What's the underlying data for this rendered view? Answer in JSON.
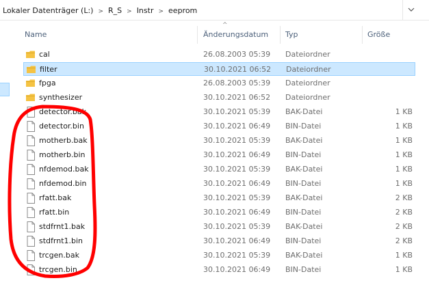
{
  "breadcrumb": [
    "Lokaler Datenträger (L:)",
    "R_S",
    "Instr",
    "eeprom"
  ],
  "columns": {
    "name": "Name",
    "date": "Änderungsdatum",
    "type": "Typ",
    "size": "Größe"
  },
  "colors": {
    "selection_bg": "#cce8ff",
    "selection_border": "#99d1ff",
    "folder": "#f5c343",
    "annotation": "#ff0000"
  },
  "files": [
    {
      "name": "cal",
      "date": "26.08.2003 05:39",
      "type": "Dateiordner",
      "size": "",
      "icon": "folder-icon"
    },
    {
      "name": "filter",
      "date": "30.10.2021 06:52",
      "type": "Dateiordner",
      "size": "",
      "icon": "folder-icon",
      "selected": true
    },
    {
      "name": "fpga",
      "date": "26.08.2003 05:39",
      "type": "Dateiordner",
      "size": "",
      "icon": "folder-icon"
    },
    {
      "name": "synthesizer",
      "date": "30.10.2021 06:52",
      "type": "Dateiordner",
      "size": "",
      "icon": "folder-icon"
    },
    {
      "name": "detector.bak",
      "date": "30.10.2021 05:39",
      "type": "BAK-Datei",
      "size": "1 KB",
      "icon": "file-icon"
    },
    {
      "name": "detector.bin",
      "date": "30.10.2021 06:49",
      "type": "BIN-Datei",
      "size": "1 KB",
      "icon": "file-icon"
    },
    {
      "name": "motherb.bak",
      "date": "30.10.2021 05:39",
      "type": "BAK-Datei",
      "size": "1 KB",
      "icon": "file-icon"
    },
    {
      "name": "motherb.bin",
      "date": "30.10.2021 06:49",
      "type": "BIN-Datei",
      "size": "1 KB",
      "icon": "file-icon"
    },
    {
      "name": "nfdemod.bak",
      "date": "30.10.2021 05:39",
      "type": "BAK-Datei",
      "size": "1 KB",
      "icon": "file-icon"
    },
    {
      "name": "nfdemod.bin",
      "date": "30.10.2021 06:49",
      "type": "BIN-Datei",
      "size": "1 KB",
      "icon": "file-icon"
    },
    {
      "name": "rfatt.bak",
      "date": "30.10.2021 05:39",
      "type": "BAK-Datei",
      "size": "2 KB",
      "icon": "file-icon"
    },
    {
      "name": "rfatt.bin",
      "date": "30.10.2021 06:49",
      "type": "BIN-Datei",
      "size": "2 KB",
      "icon": "file-icon"
    },
    {
      "name": "stdfrnt1.bak",
      "date": "30.10.2021 05:39",
      "type": "BAK-Datei",
      "size": "2 KB",
      "icon": "file-icon"
    },
    {
      "name": "stdfrnt1.bin",
      "date": "30.10.2021 06:49",
      "type": "BIN-Datei",
      "size": "2 KB",
      "icon": "file-icon"
    },
    {
      "name": "trcgen.bak",
      "date": "30.10.2021 05:39",
      "type": "BAK-Datei",
      "size": "1 KB",
      "icon": "file-icon"
    },
    {
      "name": "trcgen.bin",
      "date": "30.10.2021 06:49",
      "type": "BIN-Datei",
      "size": "1 KB",
      "icon": "file-icon"
    }
  ]
}
